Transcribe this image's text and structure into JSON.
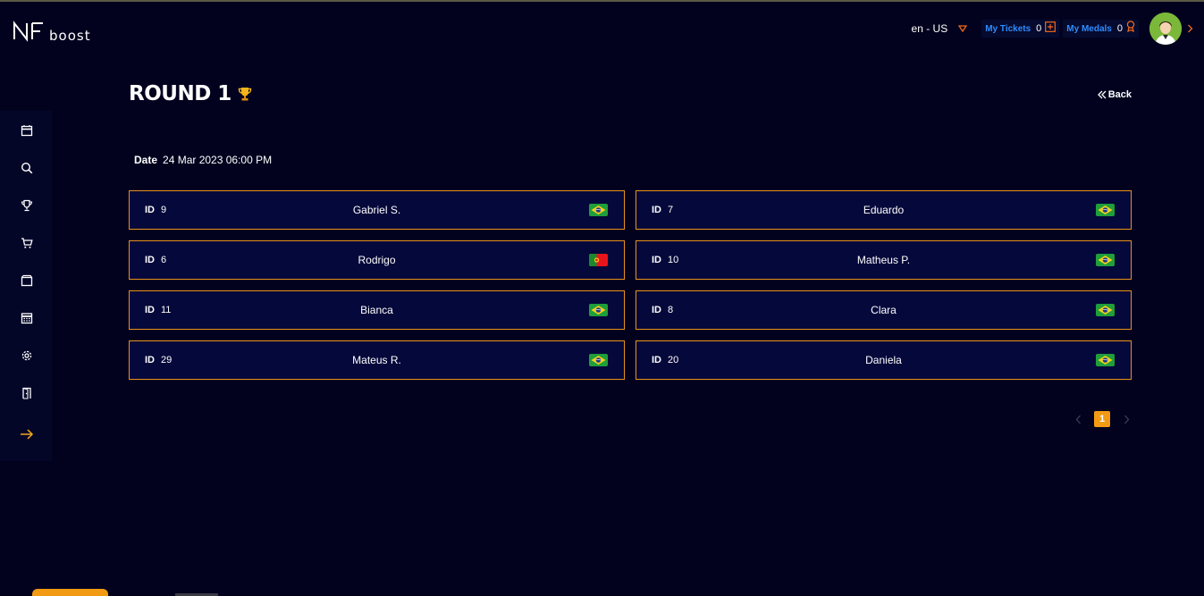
{
  "header": {
    "logo_text": "boost",
    "language": "en - US",
    "tickets_label": "My Tickets",
    "tickets_count": "0",
    "medals_label": "My Medals",
    "medals_count": "0",
    "icons": {
      "lang_dropdown": "caret-down-icon",
      "tickets": "plus-square-icon",
      "medals": "medal-icon",
      "avatar": "user-avatar",
      "menu": "chevron-right-icon"
    },
    "accent_color": "#f26a1b",
    "link_color": "#2f8cff"
  },
  "sidebar": {
    "items": [
      {
        "icon": "calendar-icon"
      },
      {
        "icon": "search-icon"
      },
      {
        "icon": "trophy-icon"
      },
      {
        "icon": "cart-icon"
      },
      {
        "icon": "box-icon"
      },
      {
        "icon": "schedule-icon"
      },
      {
        "icon": "gear-icon"
      },
      {
        "icon": "door-icon"
      },
      {
        "icon": "arrow-right-icon"
      }
    ]
  },
  "main": {
    "title": "ROUND 1",
    "back_label": "Back",
    "date_label": "Date",
    "date_value": "24 Mar 2023 06:00 PM",
    "id_label": "ID",
    "players": [
      {
        "id": "9",
        "name": "Gabriel S.",
        "flag": "brazil"
      },
      {
        "id": "7",
        "name": "Eduardo",
        "flag": "brazil"
      },
      {
        "id": "6",
        "name": "Rodrigo",
        "flag": "portugal"
      },
      {
        "id": "10",
        "name": "Matheus P.",
        "flag": "brazil"
      },
      {
        "id": "11",
        "name": "Bianca",
        "flag": "brazil"
      },
      {
        "id": "8",
        "name": "Clara",
        "flag": "brazil"
      },
      {
        "id": "29",
        "name": "Mateus R.",
        "flag": "brazil"
      },
      {
        "id": "20",
        "name": "Daniela",
        "flag": "brazil"
      }
    ],
    "card_border_color": "#e8921c"
  },
  "pagination": {
    "current_page": "1"
  }
}
